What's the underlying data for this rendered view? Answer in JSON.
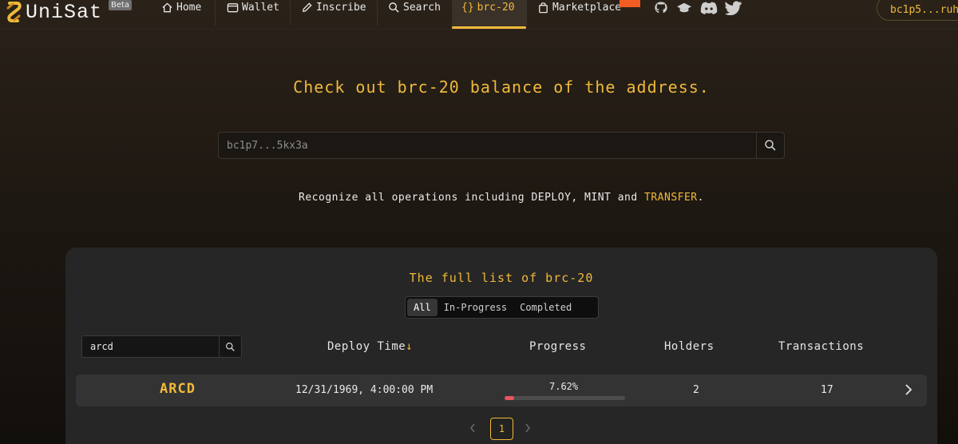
{
  "nav": {
    "brand": "UniSat",
    "beta": "Beta",
    "items": [
      {
        "label": "Home",
        "icon": "home-icon"
      },
      {
        "label": "Wallet",
        "icon": "wallet-icon"
      },
      {
        "label": "Inscribe",
        "icon": "pencil-icon"
      },
      {
        "label": "Search",
        "icon": "search-icon"
      },
      {
        "label": "brc-20",
        "icon": "braces-icon"
      },
      {
        "label": "Marketplace",
        "icon": "bag-icon"
      }
    ],
    "active": "brc-20",
    "social": [
      "github-icon",
      "graduation-cap-icon",
      "discord-icon",
      "twitter-icon"
    ],
    "address": "bc1p5...ruh",
    "accent": "#f0b93b",
    "badge_color": "#f05d23"
  },
  "hero": {
    "title": "Check out brc-20 balance of the address.",
    "search_placeholder": "bc1p7...5kx3a",
    "recognize_prefix": "Recognize all operations including DEPLOY, MINT and ",
    "recognize_highlight": "TRANSFER",
    "recognize_suffix": "."
  },
  "list": {
    "title": "The full list of brc-20",
    "tabs": [
      "All",
      "In-Progress",
      "Completed"
    ],
    "active_tab": "All",
    "filter_value": "arcd",
    "columns": {
      "deploy_time": "Deploy Time",
      "progress": "Progress",
      "holders": "Holders",
      "transactions": "Transactions"
    },
    "rows": [
      {
        "tick": "ARCD",
        "deploy_time": "12/31/1969, 4:00:00 PM",
        "progress_text": "7.62%",
        "progress": 7.62,
        "holders": "2",
        "transactions": "17"
      }
    ],
    "page": "1"
  }
}
